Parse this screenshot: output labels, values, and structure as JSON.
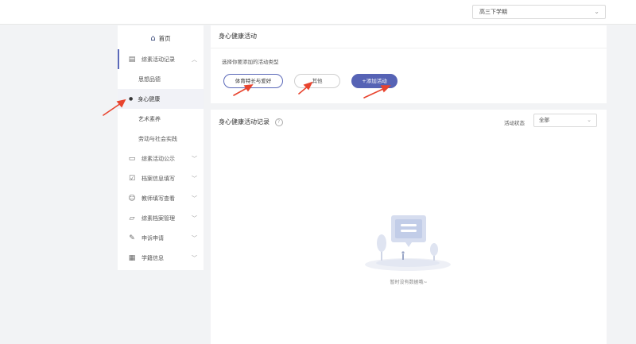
{
  "header": {
    "term_select": "高三下学期"
  },
  "sidebar": {
    "home": "首页",
    "groups": [
      {
        "label": "综素活动记录",
        "open": true
      },
      {
        "label": "综素活动公示"
      },
      {
        "label": "档案信息填写"
      },
      {
        "label": "教师填写查看"
      },
      {
        "label": "综素档案管理"
      },
      {
        "label": "申诉申请"
      },
      {
        "label": "学籍信息"
      }
    ],
    "subitems": [
      {
        "label": "思想品德"
      },
      {
        "label": "身心健康",
        "active": true
      },
      {
        "label": "艺术素养"
      },
      {
        "label": "劳动与社会实践"
      }
    ]
  },
  "activity_card": {
    "title": "身心健康活动",
    "hint": "选择你要添加的活动类型",
    "chips": [
      "体育特长与爱好",
      "其他"
    ],
    "add_button": "+添加活动"
  },
  "records_card": {
    "title": "身心健康活动记录",
    "status_label": "活动状态",
    "status_value": "全部",
    "empty_text": "暂时没有数据哦~"
  },
  "colors": {
    "accent": "#5663b5",
    "annotation_red": "#e8442e"
  },
  "icons": [
    "home-icon",
    "record-icon",
    "notice-icon",
    "form-icon",
    "user-icon",
    "folder-icon",
    "appeal-icon",
    "grid-icon",
    "chevron-down-icon",
    "question-icon"
  ]
}
